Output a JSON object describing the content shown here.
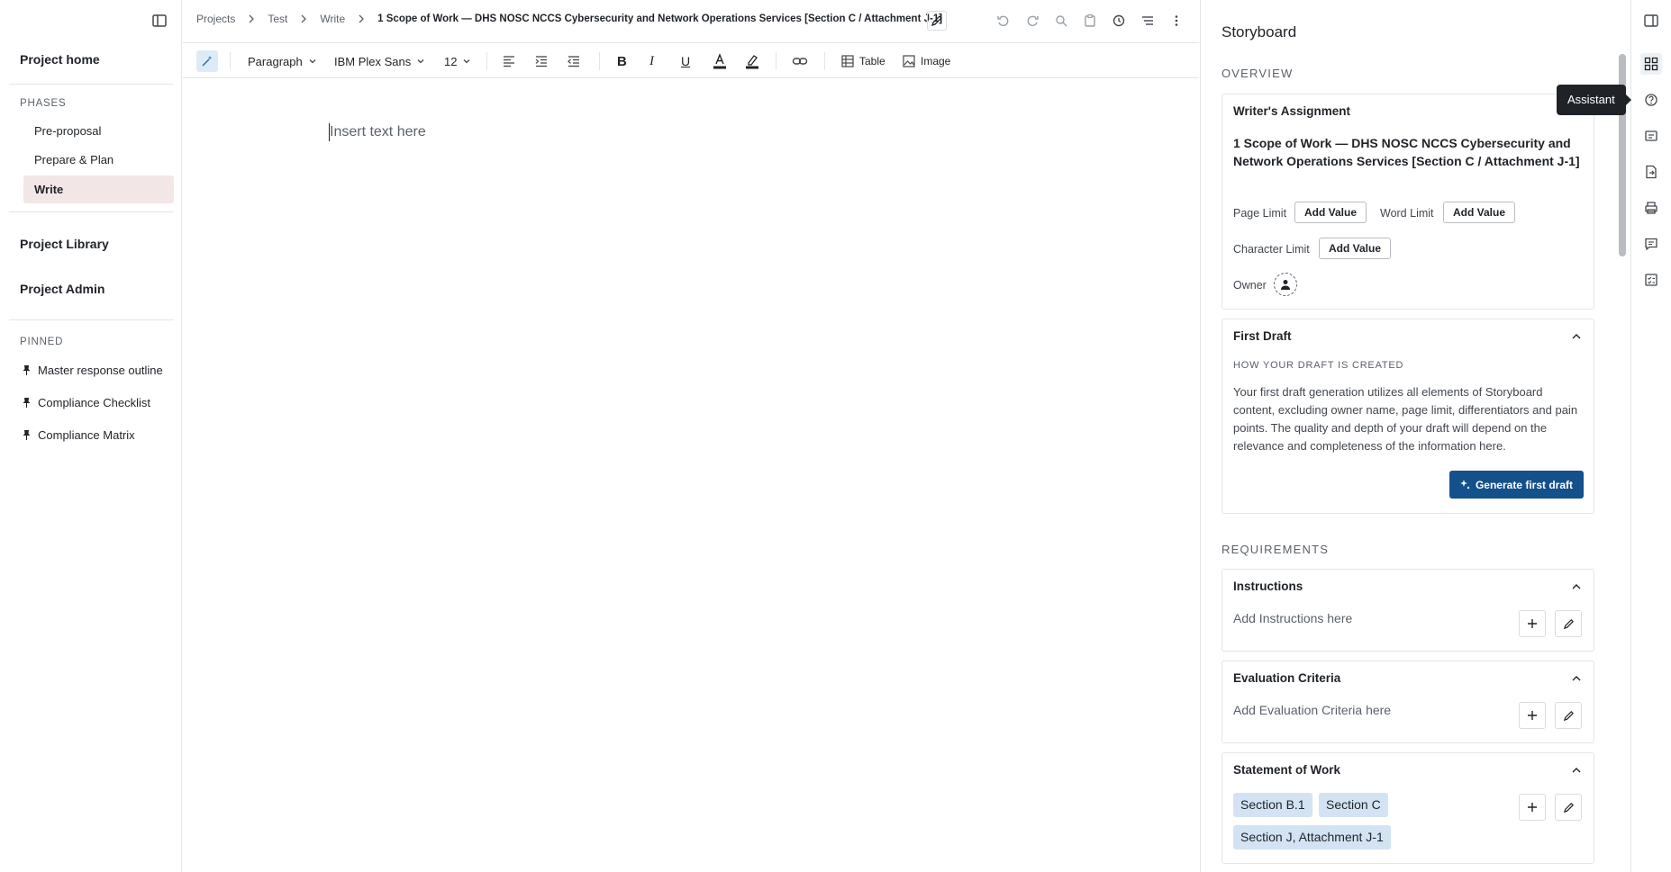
{
  "nav": {
    "project_home": "Project home",
    "phases_title": "PHASES",
    "phases": [
      {
        "label": "Pre-proposal"
      },
      {
        "label": "Prepare & Plan"
      },
      {
        "label": "Write"
      }
    ],
    "project_library": "Project Library",
    "project_admin": "Project Admin",
    "pinned_title": "PINNED",
    "pinned": [
      {
        "label": "Master response outline"
      },
      {
        "label": "Compliance Checklist"
      },
      {
        "label": "Compliance Matrix"
      }
    ]
  },
  "breadcrumb": {
    "items": [
      "Projects",
      "Test",
      "Write"
    ],
    "current": "1 Scope of Work — DHS NOSC NCCS Cybersecurity and Network Operations Services [Section C / Attachment J-1]"
  },
  "toolbar": {
    "block_type": "Paragraph",
    "font_family": "IBM Plex Sans",
    "font_size": "12",
    "table_label": "Table",
    "image_label": "Image"
  },
  "editor": {
    "placeholder": "Insert text here"
  },
  "storyboard": {
    "title": "Storyboard",
    "overview_label": "OVERVIEW",
    "writers_assignment": {
      "heading": "Writer's Assignment",
      "title": "1 Scope of Work — DHS NOSC NCCS Cybersecurity and Network Operations Services [Section C / Attachment J-1]",
      "page_limit_label": "Page Limit",
      "word_limit_label": "Word Limit",
      "character_limit_label": "Character Limit",
      "owner_label": "Owner",
      "add_value": "Add Value"
    },
    "first_draft": {
      "heading": "First Draft",
      "subheading": "HOW YOUR DRAFT IS CREATED",
      "body": "Your first draft generation utilizes all elements of Storyboard content, excluding owner name, page limit, differentiators and pain points. The quality and depth of your draft will depend on the relevance and completeness of the information here.",
      "button": "Generate first draft"
    },
    "requirements_label": "REQUIREMENTS",
    "instructions": {
      "heading": "Instructions",
      "placeholder": "Add Instructions here"
    },
    "evaluation": {
      "heading": "Evaluation Criteria",
      "placeholder": "Add Evaluation Criteria here"
    },
    "sow": {
      "heading": "Statement of Work",
      "tags": [
        "Section B.1",
        "Section C",
        "Section J, Attachment J-1"
      ]
    }
  },
  "tooltip": "Assistant",
  "colors": {
    "accent": "#14508a",
    "active_phase_bg": "#f3e6e6",
    "tag_bg": "#d3e3f3"
  }
}
